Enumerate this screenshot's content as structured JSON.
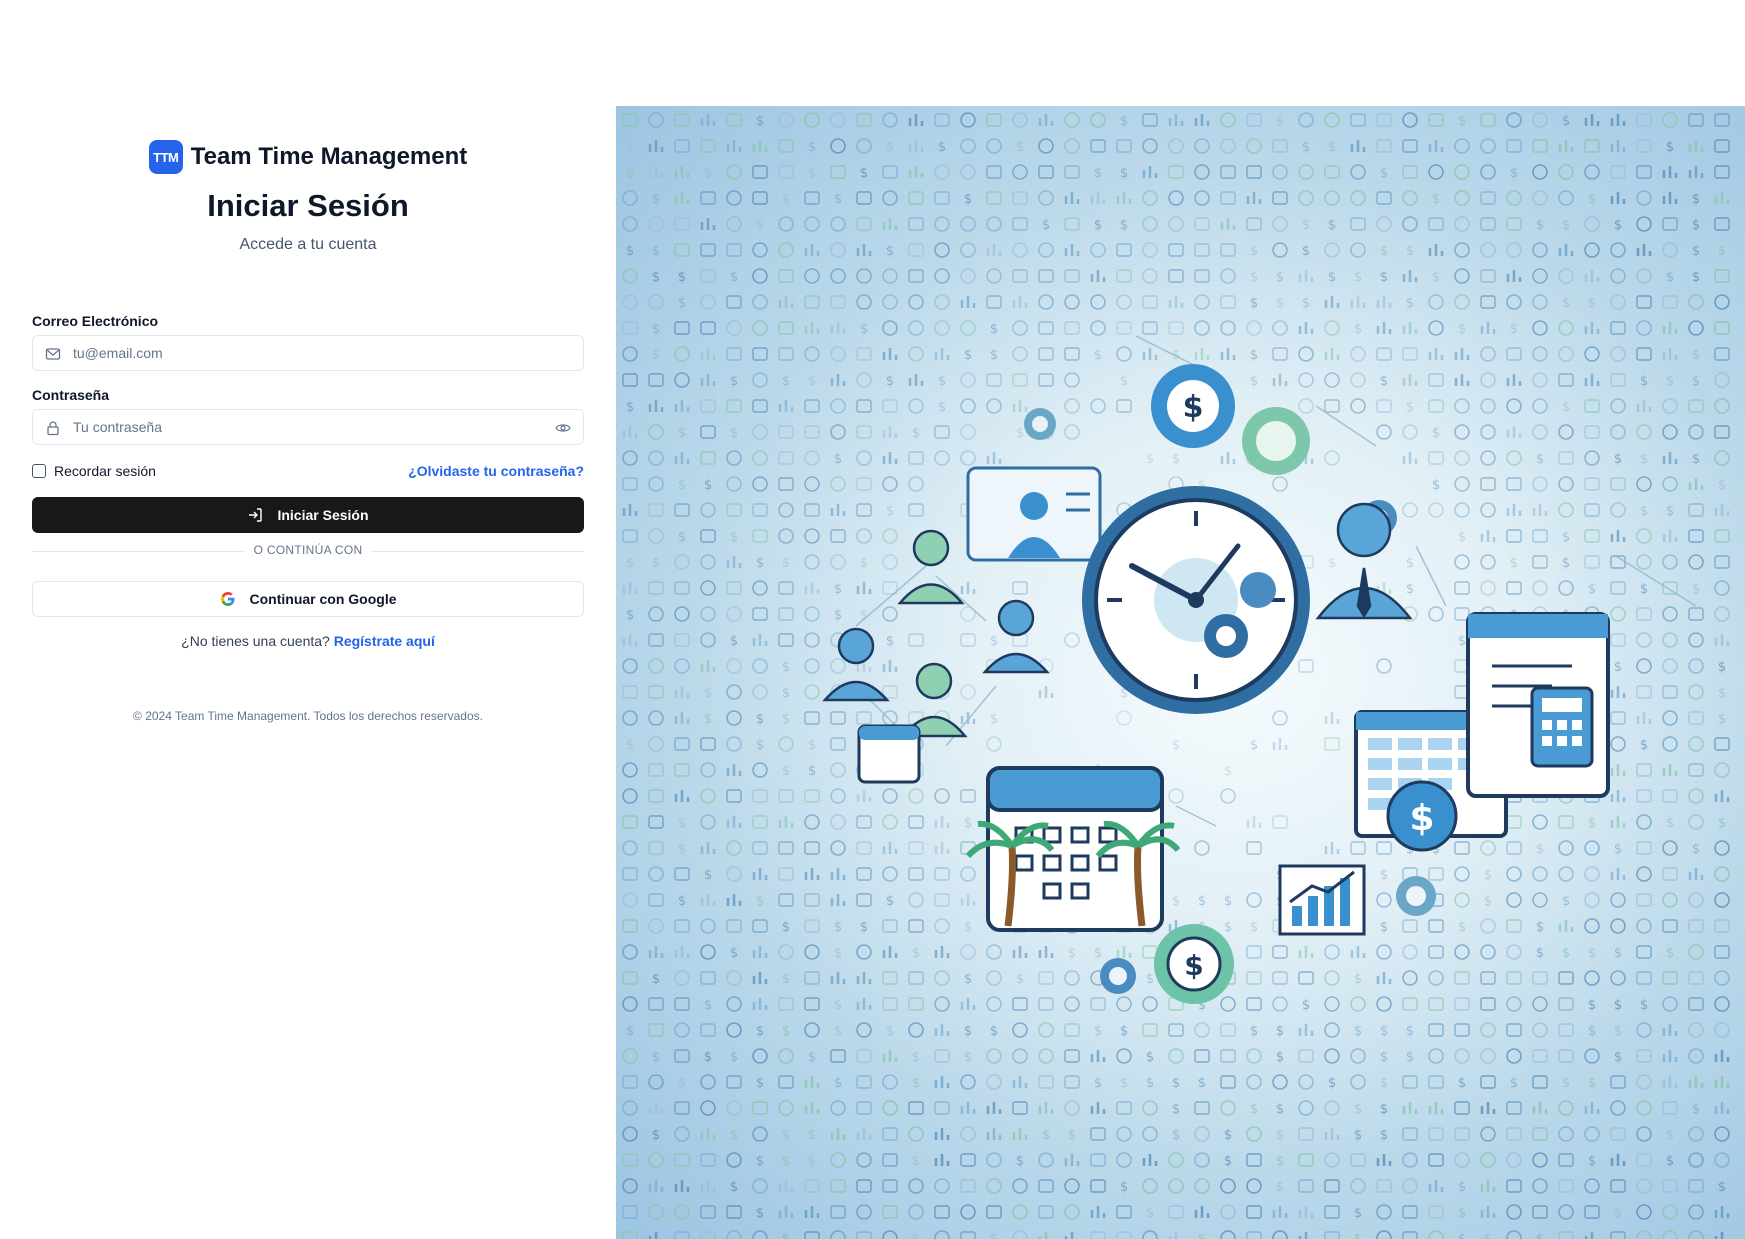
{
  "brand": {
    "logo_text": "TTM",
    "name": "Team Time Management"
  },
  "header": {
    "title": "Iniciar Sesión",
    "subtitle": "Accede a tu cuenta"
  },
  "form": {
    "email": {
      "label": "Correo Electrónico",
      "placeholder": "tu@email.com",
      "value": ""
    },
    "password": {
      "label": "Contraseña",
      "placeholder": "Tu contraseña",
      "value": ""
    },
    "remember_label": "Recordar sesión",
    "remember_checked": false,
    "forgot_link": "¿Olvidaste tu contraseña?",
    "submit_label": "Iniciar Sesión",
    "divider_text": "O CONTINÚA CON",
    "google_label": "Continuar con Google"
  },
  "signup": {
    "prompt": "¿No tienes una cuenta?",
    "link": "Regístrate aquí"
  },
  "footer": {
    "text": "© 2024 Team Time Management. Todos los derechos reservados."
  },
  "colors": {
    "accent": "#2563eb",
    "primary_button": "#18181b",
    "illustration_blue": "#4a9bd4",
    "illustration_dark": "#1e3a5f",
    "illustration_teal": "#6cc3a8"
  },
  "icons": [
    "mail-icon",
    "lock-icon",
    "eye-icon",
    "login-icon",
    "google-icon"
  ]
}
